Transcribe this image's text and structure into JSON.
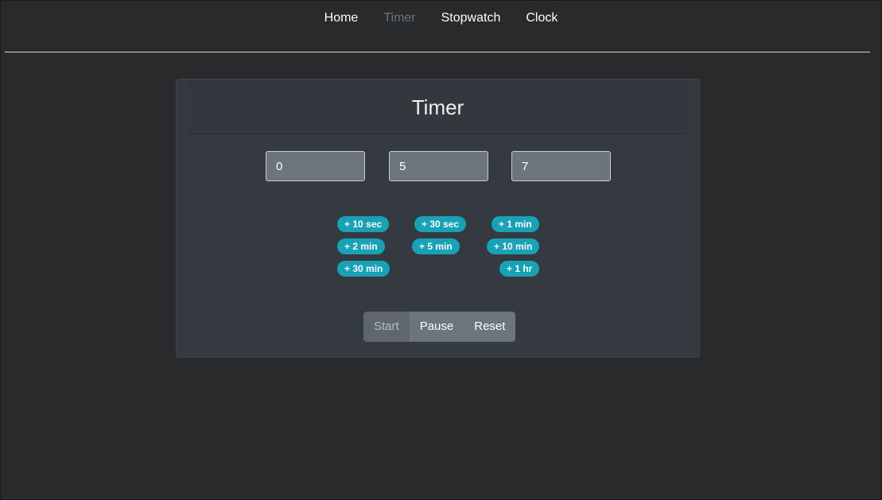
{
  "nav": {
    "items": [
      {
        "label": "Home",
        "active": false
      },
      {
        "label": "Timer",
        "active": true
      },
      {
        "label": "Stopwatch",
        "active": false
      },
      {
        "label": "Clock",
        "active": false
      }
    ]
  },
  "timer": {
    "title": "Timer",
    "inputs": {
      "hours": "0",
      "minutes": "5",
      "seconds": "7"
    },
    "quick_add": {
      "add_10_sec": "+ 10 sec",
      "add_30_sec": "+ 30 sec",
      "add_1_min": "+ 1 min",
      "add_2_min": "+ 2 min",
      "add_5_min": "+ 5 min",
      "add_10_min": "+ 10 min",
      "add_30_min": "+ 30 min",
      "add_1_hr": "+ 1 hr"
    },
    "controls": {
      "start": "Start",
      "pause": "Pause",
      "reset": "Reset",
      "start_disabled": true
    }
  },
  "colors": {
    "background": "#282a2c",
    "card": "#343a40",
    "accent_pill": "#17a2b8",
    "button": "#6c757d",
    "nav_active": "#6c757d"
  }
}
